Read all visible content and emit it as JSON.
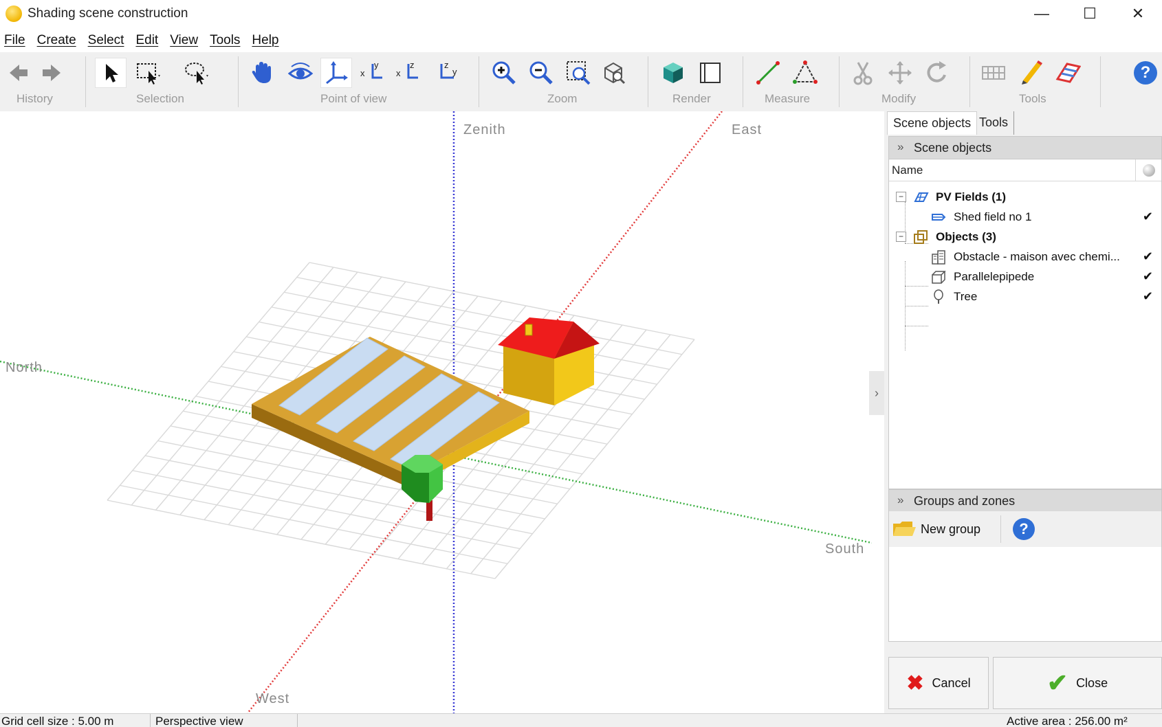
{
  "window": {
    "title": "Shading scene construction",
    "controls": {
      "minimize": "—",
      "maximize": "☐",
      "close": "✕"
    }
  },
  "menu": [
    "File",
    "Create",
    "Select",
    "Edit",
    "View",
    "Tools",
    "Help"
  ],
  "toolbar": {
    "groups": {
      "history": "History",
      "selection": "Selection",
      "point_of_view": "Point of view",
      "zoom": "Zoom",
      "render": "Render",
      "measure": "Measure",
      "modify": "Modify",
      "tools": "Tools"
    },
    "pov_axis_labels": [
      "x",
      "y",
      "x",
      "y",
      "x",
      "z",
      "z",
      "y"
    ]
  },
  "viewport": {
    "axis_labels": {
      "zenith": "Zenith",
      "east": "East",
      "north": "North",
      "south": "South",
      "west": "West"
    },
    "colors": {
      "ns_axis": "#3cb043",
      "ew_axis": "#e23b3b",
      "zenith_axis": "#3b3bd6",
      "grid": "#d9d9d9",
      "field_top": "#e8b030",
      "panel": "#c9dcf2",
      "roof": "#ee1c1c",
      "wall": "#f2c81a",
      "tree": "#2fb52f",
      "trunk": "#b01616"
    }
  },
  "right_panel": {
    "tabs": [
      "Scene objects",
      "Tools"
    ],
    "scene_objects": {
      "header": "Scene objects",
      "column_name": "Name",
      "tree": [
        {
          "label": "PV Fields (1)",
          "bold": true,
          "expander": "−",
          "icon": "pv-field-icon"
        },
        {
          "label": "Shed field no 1",
          "bold": false,
          "checked": "✔",
          "icon": "shed-field-icon"
        },
        {
          "label": "Objects (3)",
          "bold": true,
          "expander": "−",
          "icon": "objects-icon"
        },
        {
          "label": "Obstacle - maison avec chemi...",
          "bold": false,
          "checked": "✔",
          "icon": "building-icon"
        },
        {
          "label": "Parallelepipede",
          "bold": false,
          "checked": "✔",
          "icon": "box-icon"
        },
        {
          "label": "Tree",
          "bold": false,
          "checked": "✔",
          "icon": "tree-icon"
        }
      ]
    },
    "groups": {
      "header": "Groups and zones",
      "new_group": "New group",
      "help": "?"
    },
    "buttons": {
      "cancel": "Cancel",
      "close": "Close"
    },
    "collapse_glyph": "›",
    "section_chevron": "»"
  },
  "status": {
    "grid": "Grid cell size : 5.00 m",
    "view": "Perspective view",
    "active_area": "Active area : 256.00 m²"
  },
  "help_glyph": "?"
}
